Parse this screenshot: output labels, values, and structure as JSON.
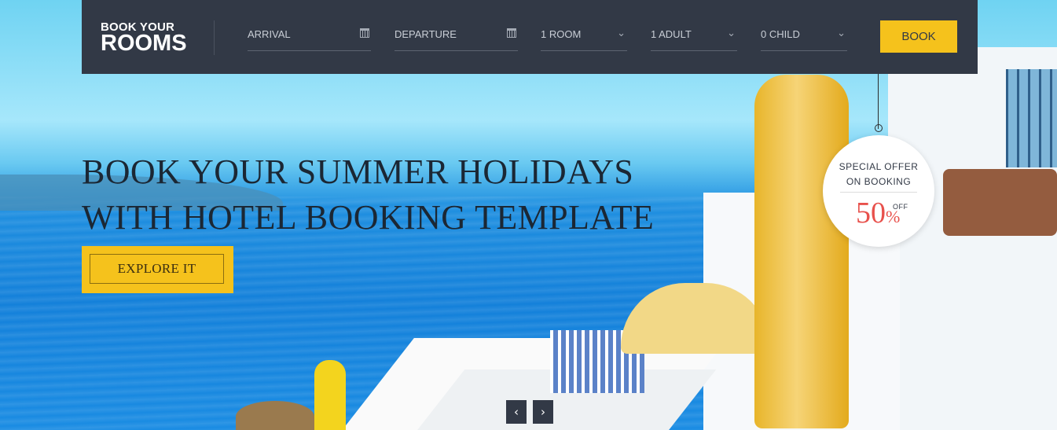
{
  "brand": {
    "line1": "BOOK YOUR",
    "line2": "ROOMS"
  },
  "booking_form": {
    "arrival_label": "ARRIVAL",
    "departure_label": "DEPARTURE",
    "rooms_value": "1 ROOM",
    "adults_value": "1 ADULT",
    "children_value": "0 CHILD",
    "book_label": "BOOK",
    "calendar_icon": "calendar-icon",
    "dropdown_icon": "chevron-down-icon"
  },
  "hero": {
    "headline_line1": "BOOK YOUR SUMMER HOLIDAYS",
    "headline_line2": "WITH HOTEL BOOKING TEMPLATE",
    "cta_label": "EXPLORE IT"
  },
  "offer": {
    "line1": "SPECIAL OFFER",
    "line2": "ON BOOKING",
    "percent": "50",
    "percent_sign": "%",
    "off_label": "OFF"
  },
  "slider": {
    "prev_icon": "‹",
    "next_icon": "›"
  },
  "colors": {
    "bar": "#323946",
    "accent": "#f5c21c",
    "offer_red": "#e8514c"
  }
}
